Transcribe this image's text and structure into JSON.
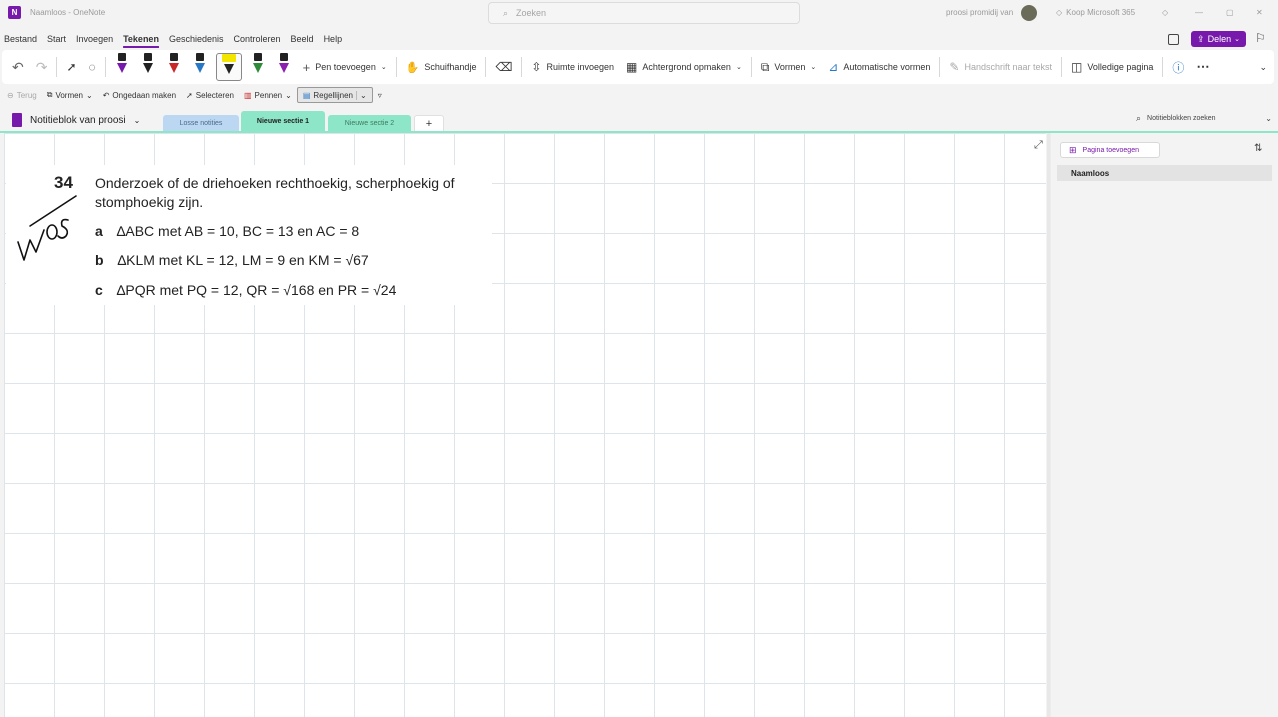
{
  "titlebar": {
    "doc_title": "Naamloos",
    "separator": "-",
    "app_name": "OneNote",
    "search_placeholder": "Zoeken",
    "user_name": "proosi promidij van",
    "buy_label": "Koop Microsoft 365"
  },
  "menubar": {
    "items": [
      "Bestand",
      "Start",
      "Invoegen",
      "Tekenen",
      "Geschiedenis",
      "Controleren",
      "Beeld",
      "Help"
    ],
    "share_label": "Delen"
  },
  "ribbon": {
    "add_pen": "Pen toevoegen",
    "hand": "Schuifhandje",
    "insert_space": "Ruimte invoegen",
    "background": "Achtergrond opmaken",
    "shapes": "Vormen",
    "auto_shapes": "Automatische vormen",
    "ink_to_text": "Handschrift naar tekst",
    "full_page": "Volledige pagina",
    "pen_colors": [
      "#7719aa",
      "#222222",
      "#c82828",
      "#2878c8",
      "#f2e600",
      "#2e8b3a",
      "#8a1fb0"
    ]
  },
  "quickbar": {
    "back": "Terug",
    "shapes": "Vormen",
    "undo": "Ongedaan maken",
    "select": "Selecteren",
    "pens": "Pennen",
    "lines": "Regellijnen"
  },
  "notebook": {
    "name": "Notitieblok van proosi",
    "tabs": [
      "Losse notities",
      "Nieuwe sectie 1",
      "Nieuwe sectie 2"
    ],
    "add_tab": "+",
    "search_placeholder": "Notitieblokken zoeken"
  },
  "sidepanel": {
    "add_page": "Pagina toevoegen",
    "pages": [
      "Naamloos"
    ]
  },
  "exercise": {
    "number": "34",
    "handwriting": "vwo5",
    "prompt_line1": "Onderzoek of de driehoeken rechthoekig, scherphoekig of",
    "prompt_line2": "stomphoekig zijn.",
    "items": [
      {
        "label": "a",
        "text": "∆ABC met AB = 10, BC = 13 en AC = 8"
      },
      {
        "label": "b",
        "text": "∆KLM met KL = 12, LM = 9 en KM = √67"
      },
      {
        "label": "c",
        "text": "∆PQR met PQ = 12, QR = √168 en PR = √24"
      }
    ]
  }
}
